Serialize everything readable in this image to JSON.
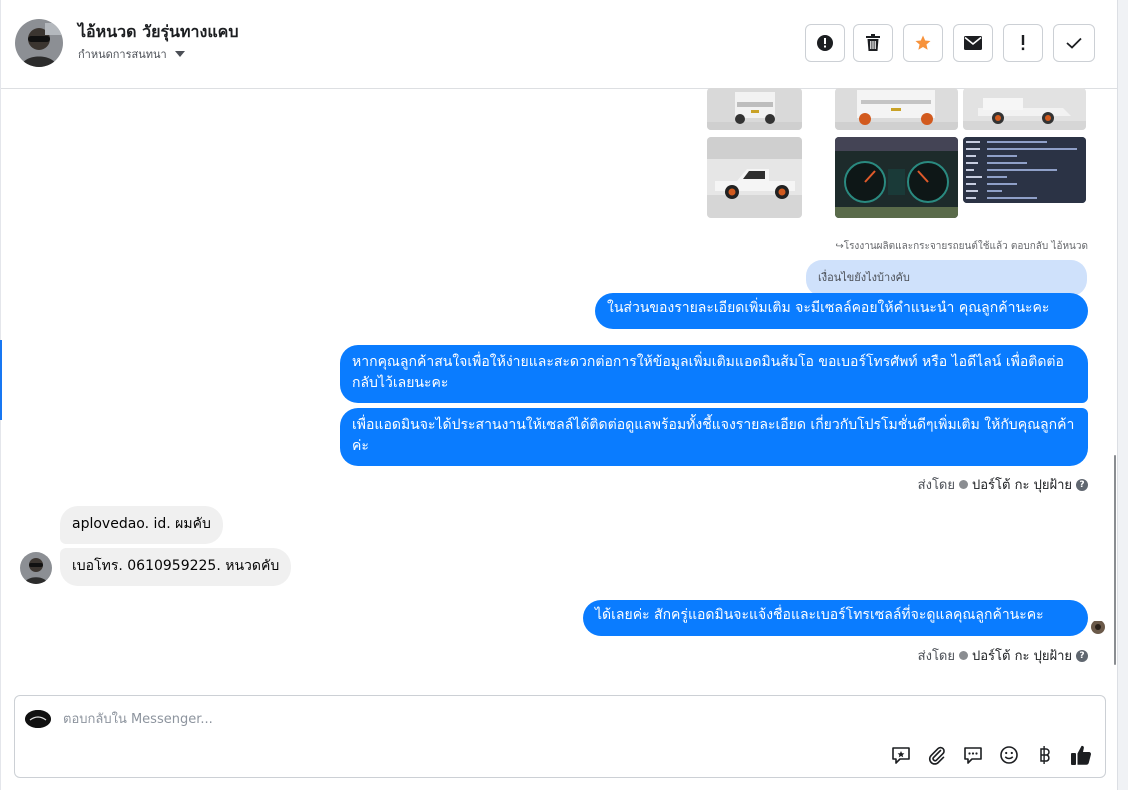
{
  "header": {
    "contact_name": "ไอ้หนวด วัยรุ่นทางแคบ",
    "assign_label": "กำหนดการสนทนา",
    "actions": [
      {
        "icon": "alert-circle-icon",
        "name": "mark-spam-button"
      },
      {
        "icon": "trash-icon",
        "name": "delete-button"
      },
      {
        "icon": "star-icon",
        "name": "star-button"
      },
      {
        "icon": "envelope-icon",
        "name": "mark-unread-button"
      },
      {
        "icon": "exclamation-icon",
        "name": "follow-up-button"
      },
      {
        "icon": "check-icon",
        "name": "mark-done-button"
      }
    ]
  },
  "gallery": {
    "spec_card_rows": [
      "ชื่อรุ่นรถ",
      "ขนาด",
      "ปี",
      "เลขไมล์",
      "สี",
      "เกียร์",
      "ราคา"
    ]
  },
  "thread": {
    "reply_note": "↪โรงงานผลิตและกระจายรถยนต์ใช้แล้ว ตอบกลับ ไอ้หนวด",
    "quoted_message": "เงื่อนไขยังไงบ้างคับ",
    "out_messages": [
      "ในส่วนของรายละเอียดเพิ่มเติม จะมีเซลล์คอยให้คำแนะนำ คุณลูกค้านะคะ",
      "หากคุณลูกค้าสนใจเพื่อให้ง่ายและสะดวกต่อการให้ข้อมูลเพิ่มเติมแอดมินส้มโอ ขอเบอร์โทรศัพท์ หรือ ไอดีไลน์ เพื่อติดต่อกลับไว้เลยนะคะ",
      "เพื่อแอดมินจะได้ประสานงานให้เซลล์ได้ติดต่อดูแลพร้อมทั้งชี้แจงรายละเอียด เกี่ยวกับโปรโมชั่นดีๆเพิ่มเติม ให้กับคุณลูกค้าค่ะ"
    ],
    "sent_by_prefix": "ส่งโดย",
    "sent_by_name": "ปอร์โต้ กะ ปุยฝ้าย",
    "in_messages": [
      "aplovedao.   id. ผมคับ",
      "เบอโทร. 0610959225. หนวดคับ"
    ],
    "last_out_message": "ได้เลยค่ะ สักครู่แอดมินจะแจ้งชื่อและเบอร์โทรเซลล์ที่จะดูแลคุณลูกค้านะคะ"
  },
  "composer": {
    "placeholder": "ตอบกลับใน Messenger...",
    "tools": [
      "sticker-icon",
      "paperclip-icon",
      "chat-bubble-icon",
      "smiley-icon",
      "baht-icon",
      "thumbs-up-icon"
    ]
  },
  "colors": {
    "outgoing": "#0a7cff",
    "incoming": "#f0f0f0",
    "quoted": "#cfe1fb",
    "star": "#f7923b"
  }
}
